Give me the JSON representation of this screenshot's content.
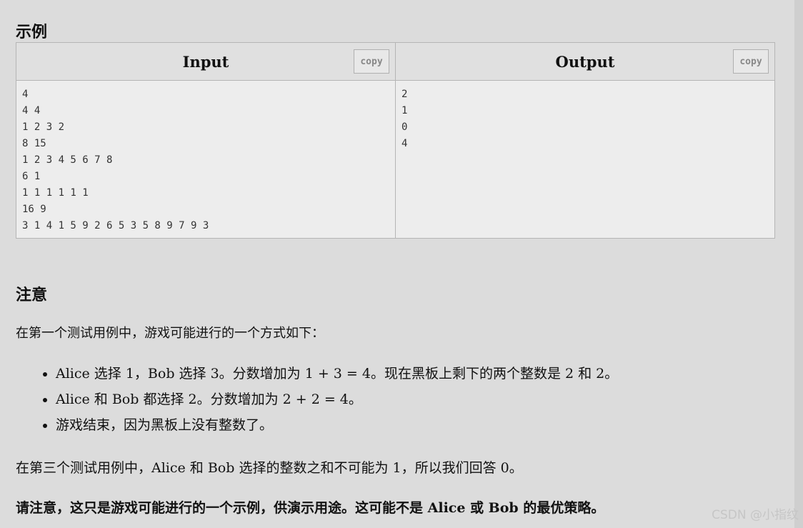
{
  "sections": {
    "example_title": "示例",
    "note_title": "注意"
  },
  "samples": {
    "input_header": "Input",
    "output_header": "Output",
    "copy_label": "copy",
    "input_text": "4\n4 4\n1 2 3 2\n8 15\n1 2 3 4 5 6 7 8\n6 1\n1 1 1 1 1 1\n16 9\n3 1 4 1 5 9 2 6 5 3 5 8 9 7 9 3",
    "output_text": "2\n1\n0\n4"
  },
  "note": {
    "intro": "在第一个测试用例中，游戏可能进行的一个方式如下：",
    "items": [
      "Alice 选择 1，Bob 选择 3。分数增加为 1 + 3 = 4。现在黑板上剩下的两个整数是 2 和 2。",
      "Alice 和 Bob 都选择 2。分数增加为 2 + 2 = 4。",
      "游戏结束，因为黑板上没有整数了。"
    ],
    "third_case": "在第三个测试用例中，Alice 和 Bob 选择的整数之和不可能为 1，所以我们回答 0。",
    "emphasis": "请注意，这只是游戏可能进行的一个示例，供演示用途。这可能不是 Alice 或 Bob 的最优策略。"
  },
  "watermark": "CSDN @小指纹"
}
